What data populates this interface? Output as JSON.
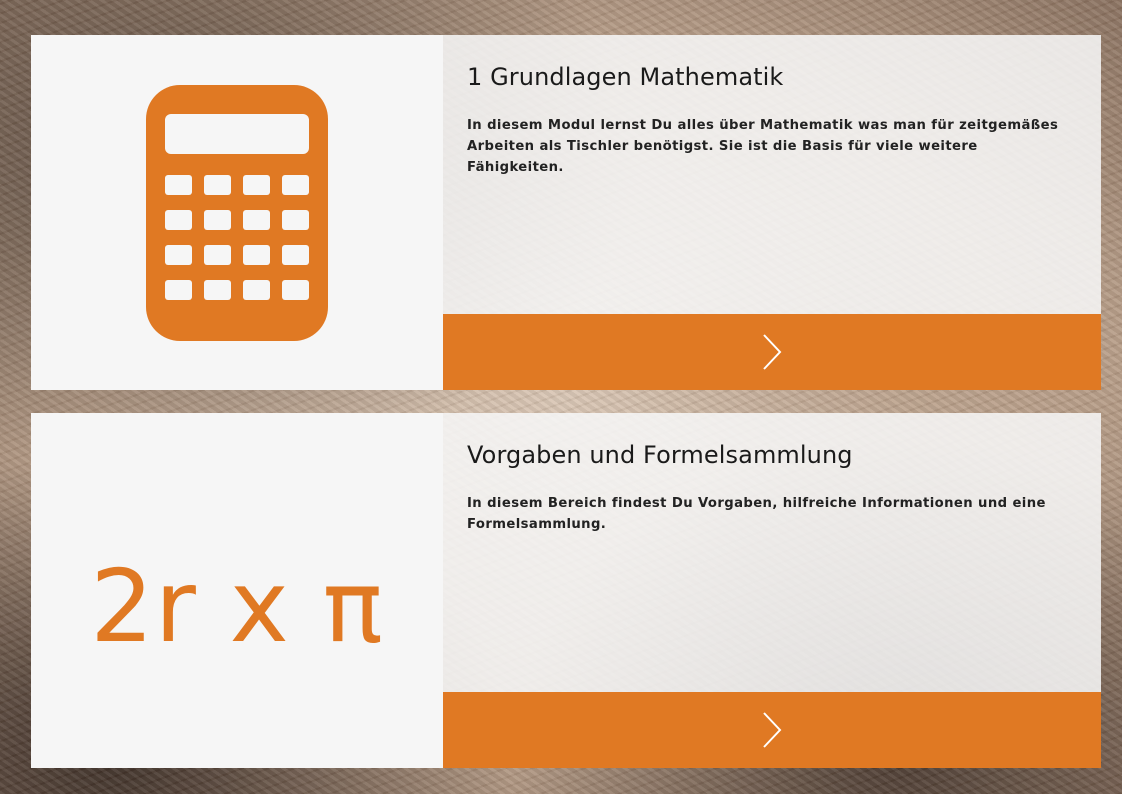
{
  "colors": {
    "accent": "#e07923",
    "card_bg": "#f6f6f6"
  },
  "cards": [
    {
      "icon": "calculator-icon",
      "title": "1 Grundlagen Mathematik",
      "description": "In diesem Modul lernst Du alles über Mathematik was man für zeitgemäßes Arbeiten als Tischler benötigst. Sie ist die Basis für viele weitere Fähigkeiten.",
      "action_icon": "chevron-right-icon"
    },
    {
      "icon_text": "2r x π",
      "title": "Vorgaben und Formelsammlung",
      "description": "In diesem Bereich findest Du Vorgaben, hilfreiche Informationen und eine Formelsammlung.",
      "action_icon": "chevron-right-icon"
    }
  ]
}
